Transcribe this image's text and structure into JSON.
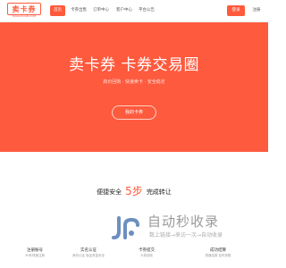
{
  "header": {
    "logo_text": "卖卡券",
    "logo_subtitle": "MAIKAQUAN.COM",
    "nav": [
      {
        "label": "首页",
        "active": true
      },
      {
        "label": "卡券出售",
        "active": false
      },
      {
        "label": "订单中心",
        "active": false
      },
      {
        "label": "客户中心",
        "active": false
      },
      {
        "label": "平台公告",
        "active": false
      }
    ],
    "login_label": "登录",
    "register_label": "注册"
  },
  "hero": {
    "title": "卖卡券 卡券交易圈",
    "subtitle": "高价回购 · 快速卖卡 · 安全稳定",
    "button_label": "我的卡券"
  },
  "slogan": {
    "before": "便捷安全",
    "highlight": "5步",
    "after": "完成转让"
  },
  "watermark": {
    "title": "自动秒收录",
    "subtitle": "数上链接→来访一次→自动收录"
  },
  "features": [
    {
      "title": "注册账号",
      "desc": "30秒快速注册"
    },
    {
      "title": "实名认证",
      "desc": "身份认证 保证资金安全"
    },
    {
      "title": "卡券提交",
      "desc": "卡券回收"
    },
    {
      "title": "成功结算",
      "desc": "快速结算 及时到账"
    }
  ],
  "colors": {
    "accent": "#ff5a3c",
    "hero_bg": "#fe5a3e"
  }
}
